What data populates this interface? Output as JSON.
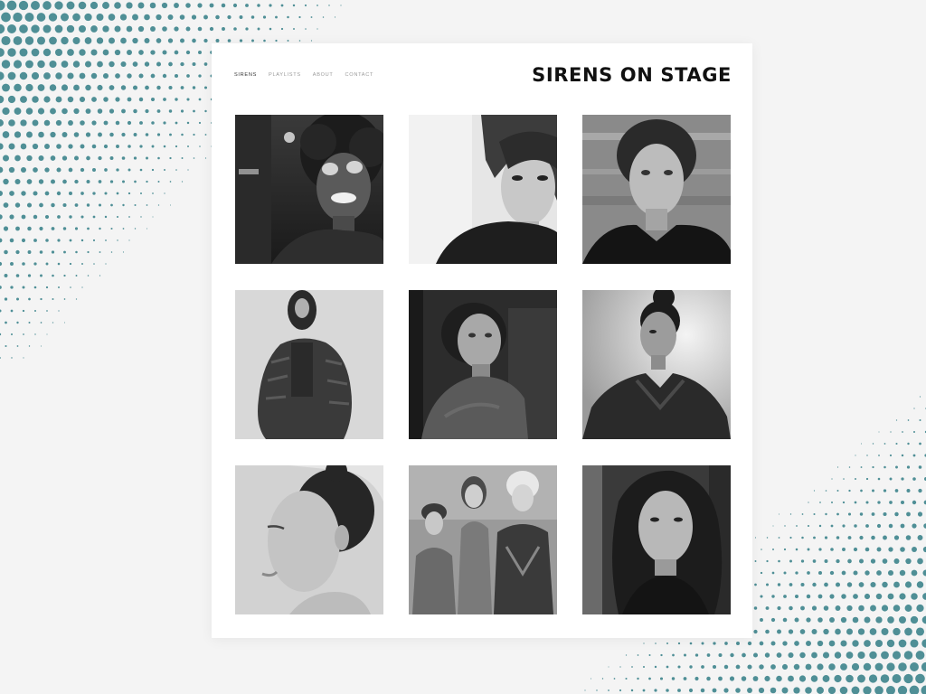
{
  "site": {
    "title": "SIRENS ON STAGE",
    "accent_dot_color": "#4f8f96"
  },
  "nav": {
    "items": [
      {
        "label": "SIRENS",
        "active": true
      },
      {
        "label": "PLAYLISTS",
        "active": false
      },
      {
        "label": "ABOUT",
        "active": false
      },
      {
        "label": "CONTACT",
        "active": false
      }
    ]
  },
  "gallery": {
    "photos": [
      {
        "subject": "portrait-glitter-eyes-curly-hair"
      },
      {
        "subject": "portrait-short-hair-knit-top"
      },
      {
        "subject": "portrait-hair-tied-back-v-neck"
      },
      {
        "subject": "full-figure-ruffled-dress"
      },
      {
        "subject": "portrait-seated-dark-hair"
      },
      {
        "subject": "portrait-top-bun-sculptural-jacket"
      },
      {
        "subject": "profile-eyes-closed"
      },
      {
        "subject": "group-three-women"
      },
      {
        "subject": "portrait-long-dark-hair-turtleneck"
      }
    ]
  }
}
